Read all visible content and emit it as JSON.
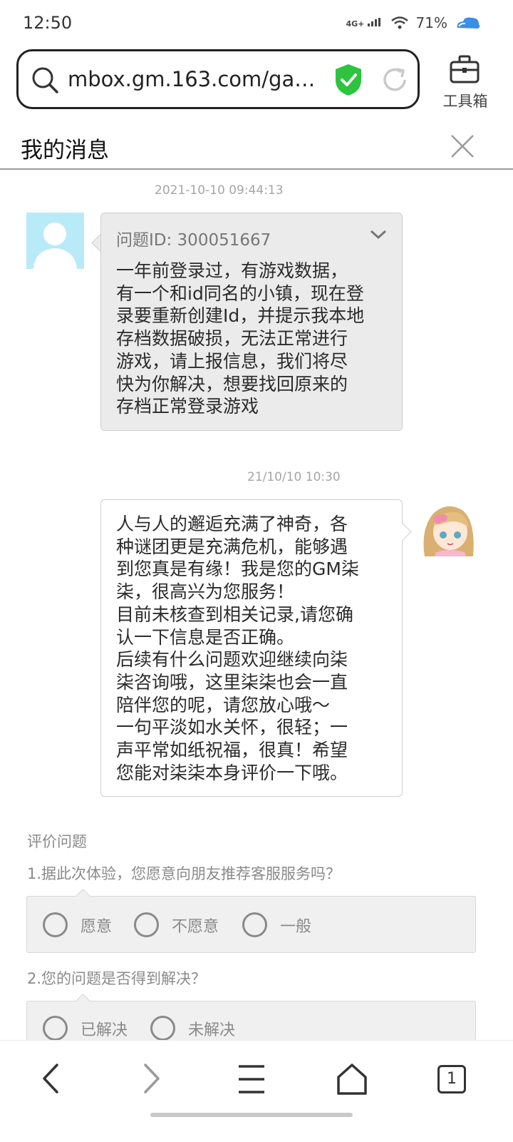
{
  "status_bar": {
    "time": "12:50",
    "network": "4G+",
    "battery": "71%"
  },
  "url_bar": {
    "url": "mbox.gm.163.com/gam…",
    "toolbox_label": "工具箱"
  },
  "header": {
    "title": "我的消息"
  },
  "messages": [
    {
      "timestamp": "2021-10-10 09:44:13",
      "question_id": "问题ID: 300051667",
      "text": "一年前登录过，有游戏数据，\n有一个和id同名的小镇，现在登\n录要重新创建Id，并提示我本地\n存档数据破损，无法正常进行\n游戏，请上报信息，我们将尽\n快为你解决，想要找回原来的\n存档正常登录游戏"
    },
    {
      "timestamp": "21/10/10 10:30",
      "text": "人与人的邂逅充满了神奇，各\n种谜团更是充满危机，能够遇\n到您真是有缘！我是您的GM柒\n柒，很高兴为您服务！\n目前未核查到相关记录,请您确\n认一下信息是否正确。\n后续有什么问题欢迎继续向柒\n柒咨询哦，这里柒柒也会一直\n陪伴您的呢，请您放心哦～\n一句平淡如水关怀，很轻；一\n声平常如纸祝福，很真！希望\n您能对柒柒本身评价一下哦。"
    }
  ],
  "rating": {
    "title": "评价问题",
    "questions": [
      {
        "text": "1.据此次体验，您愿意向朋友推荐客服服务吗？",
        "options": [
          "愿意",
          "不愿意",
          "一般"
        ]
      },
      {
        "text": "2.您的问题是否得到解决？",
        "options": [
          "已解决",
          "未解决"
        ]
      }
    ]
  },
  "nav": {
    "tab_count": "1"
  },
  "colors": {
    "shield": "#2ec440",
    "user_avatar_bg": "#b8ebf7",
    "bubble_gray": "#ebebeb"
  }
}
